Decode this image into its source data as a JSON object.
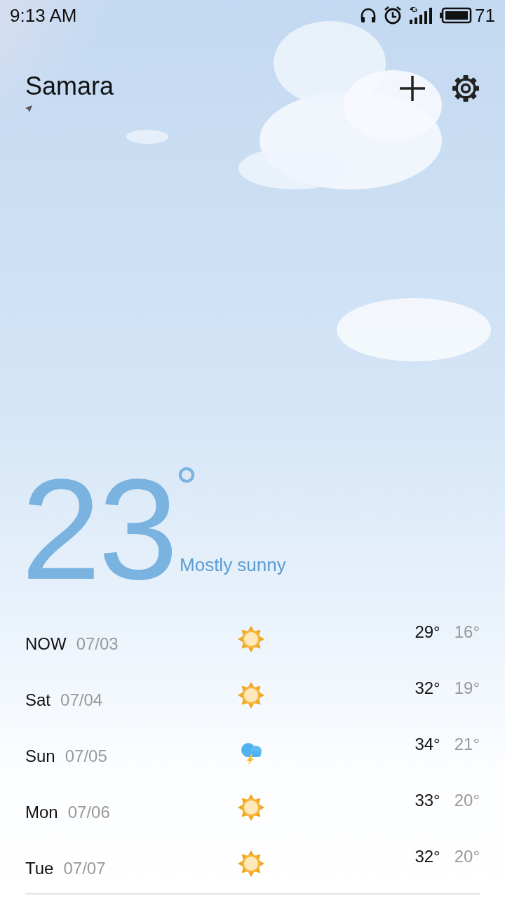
{
  "status_bar": {
    "time": "9:13 AM",
    "battery": "71"
  },
  "header": {
    "city": "Samara"
  },
  "current": {
    "temperature": "23",
    "degree": "°",
    "condition": "Mostly sunny"
  },
  "forecast": [
    {
      "day": "NOW",
      "date": "07/03",
      "kind": "sunny",
      "high": "29°",
      "low": "16°"
    },
    {
      "day": "Sat",
      "date": "07/04",
      "kind": "sunny",
      "high": "32°",
      "low": "19°"
    },
    {
      "day": "Sun",
      "date": "07/05",
      "kind": "thunderstorm",
      "high": "34°",
      "low": "21°"
    },
    {
      "day": "Mon",
      "date": "07/06",
      "kind": "sunny",
      "high": "33°",
      "low": "20°"
    },
    {
      "day": "Tue",
      "date": "07/07",
      "kind": "sunny",
      "high": "32°",
      "low": "20°"
    }
  ]
}
